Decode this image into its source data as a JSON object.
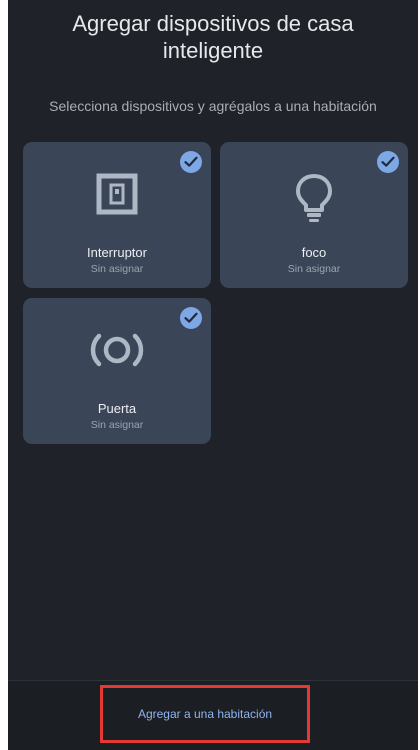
{
  "header": {
    "title_line1": "Agregar dispositivos de casa",
    "title_line2": "inteligente",
    "subtitle": "Selecciona dispositivos y agrégalos a una habitación"
  },
  "devices": [
    {
      "name": "Interruptor",
      "status": "Sin asignar",
      "icon": "switch-icon",
      "selected": true
    },
    {
      "name": "foco",
      "status": "Sin asignar",
      "icon": "light-bulb-icon",
      "selected": true
    },
    {
      "name": "Puerta",
      "status": "Sin asignar",
      "icon": "broadcast-sensor-icon",
      "selected": true
    }
  ],
  "footer": {
    "add_to_room_label": "Agregar a una habitación"
  },
  "colors": {
    "background": "#1f2228",
    "card": "#3a4657",
    "check": "#7ea7e6",
    "action_text": "#8fb4f0",
    "highlight": "#e53935"
  }
}
